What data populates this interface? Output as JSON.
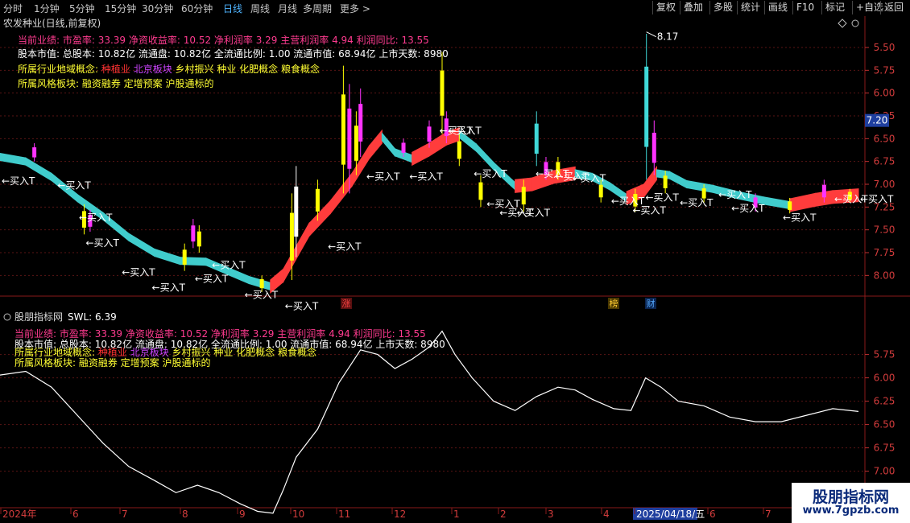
{
  "toolbar": {
    "left": [
      {
        "label": "分时",
        "active": false
      },
      {
        "label": "1分钟",
        "active": false
      },
      {
        "label": "5分钟",
        "active": false
      },
      {
        "label": "15分钟",
        "active": false
      },
      {
        "label": "30分钟",
        "active": false
      },
      {
        "label": "60分钟",
        "active": false
      },
      {
        "label": "日线",
        "active": true
      },
      {
        "label": "周线",
        "active": false
      },
      {
        "label": "月线",
        "active": false
      },
      {
        "label": "多周期",
        "active": false
      },
      {
        "label": "更多 >",
        "active": false
      }
    ],
    "right": [
      "复权",
      "叠加",
      "多股",
      "统计",
      "画线",
      "F10",
      "标记",
      "+自选",
      "返回"
    ]
  },
  "main": {
    "title": "农发种业(日线,前复权)",
    "info_lines": [
      {
        "text": "当前业绩: 市盈率: 33.39 净资收益率: 10.52 净利润率 3.29 主营利润率 4.94 利润同比: 13.55",
        "color": "#ff3b8f"
      },
      {
        "text": "股本市值: 总股本: 10.82亿 流通盘: 10.82亿 全流通比例: 1.00 流通市值: 68.94亿 上市天数: 8980",
        "color": "#ffffff"
      },
      {
        "parts": [
          {
            "text": "所属行业地域概念:",
            "color": "#ffff33"
          },
          {
            "text": "种植业",
            "color": "#ff3333"
          },
          {
            "text": "北京板块",
            "color": "#cc44ff"
          },
          {
            "text": "乡村振兴 种业 化肥概念 粮食概念",
            "color": "#ffff33"
          }
        ]
      },
      {
        "parts": [
          {
            "text": "所属风格板块:",
            "color": "#ffff33"
          },
          {
            "text": "融资融券 定增预案 沪股通标的",
            "color": "#ffff33"
          }
        ]
      }
    ],
    "y_ticks": [
      "8.00",
      "7.75",
      "7.50",
      "7.25",
      "7.00",
      "6.75",
      "6.50",
      "6.25",
      "6.00",
      "5.75",
      "5.50"
    ],
    "current_price": "7.20",
    "high_label": "8.17",
    "buy_label": "←买入T",
    "event_badges": [
      {
        "label": "涨",
        "color": "#ff4444",
        "bg": "#5a1010"
      },
      {
        "label": "榜",
        "color": "#ffcc33",
        "bg": "#4a3800"
      },
      {
        "label": "财",
        "color": "#55aaff",
        "bg": "#0a2450"
      }
    ]
  },
  "sub": {
    "title": "股朋指标网",
    "value_label": "SWL: 6.39",
    "y_ticks": [
      "7.00",
      "6.75",
      "6.50",
      "6.25",
      "6.00",
      "5.75"
    ]
  },
  "x_axis": {
    "labels": [
      "2024年",
      "6",
      "7",
      "8",
      "9",
      "10",
      "11",
      "12",
      "1",
      "2",
      "3",
      "4",
      "2025/04/18/五",
      "6",
      "7"
    ]
  },
  "watermark": {
    "line1": "股朋指标网",
    "line2": "www.7gpzb.com"
  },
  "colors": {
    "up": "#ff3232",
    "down": "#40d8d8",
    "band_up": "#ff3c3c",
    "band_down": "#40cccc",
    "buy": "#ffffff",
    "candle_hi": "#ffff00",
    "candle_mag": "#ff33ff"
  },
  "chart_data": [
    {
      "type": "candlestick-band",
      "title": "农发种业(日线,前复权)",
      "x_range": [
        "2024-04",
        "2025-08"
      ],
      "ylim": [
        5.3,
        8.3
      ],
      "y_ticks": [
        5.5,
        5.75,
        6.0,
        6.25,
        6.5,
        6.75,
        7.0,
        7.25,
        7.5,
        7.75,
        8.0
      ],
      "band": [
        {
          "x": 0.0,
          "y": 6.8
        },
        {
          "x": 0.03,
          "y": 6.75
        },
        {
          "x": 0.06,
          "y": 6.58
        },
        {
          "x": 0.09,
          "y": 6.35
        },
        {
          "x": 0.12,
          "y": 6.15
        },
        {
          "x": 0.15,
          "y": 5.92
        },
        {
          "x": 0.18,
          "y": 5.75
        },
        {
          "x": 0.21,
          "y": 5.66
        },
        {
          "x": 0.24,
          "y": 5.65
        },
        {
          "x": 0.265,
          "y": 5.55
        },
        {
          "x": 0.29,
          "y": 5.45
        },
        {
          "x": 0.315,
          "y": 5.38
        },
        {
          "x": 0.33,
          "y": 5.5
        },
        {
          "x": 0.345,
          "y": 5.75
        },
        {
          "x": 0.36,
          "y": 6.0
        },
        {
          "x": 0.385,
          "y": 6.25
        },
        {
          "x": 0.41,
          "y": 6.55
        },
        {
          "x": 0.43,
          "y": 6.85
        },
        {
          "x": 0.445,
          "y": 7.02
        },
        {
          "x": 0.46,
          "y": 6.85
        },
        {
          "x": 0.48,
          "y": 6.78
        },
        {
          "x": 0.5,
          "y": 6.88
        },
        {
          "x": 0.52,
          "y": 7.0
        },
        {
          "x": 0.535,
          "y": 7.05
        },
        {
          "x": 0.555,
          "y": 6.9
        },
        {
          "x": 0.575,
          "y": 6.7
        },
        {
          "x": 0.6,
          "y": 6.48
        },
        {
          "x": 0.62,
          "y": 6.5
        },
        {
          "x": 0.645,
          "y": 6.58
        },
        {
          "x": 0.67,
          "y": 6.62
        },
        {
          "x": 0.69,
          "y": 6.58
        },
        {
          "x": 0.71,
          "y": 6.48
        },
        {
          "x": 0.73,
          "y": 6.35
        },
        {
          "x": 0.75,
          "y": 6.43
        },
        {
          "x": 0.765,
          "y": 6.62
        },
        {
          "x": 0.78,
          "y": 6.6
        },
        {
          "x": 0.8,
          "y": 6.5
        },
        {
          "x": 0.83,
          "y": 6.45
        },
        {
          "x": 0.86,
          "y": 6.38
        },
        {
          "x": 0.89,
          "y": 6.32
        },
        {
          "x": 0.92,
          "y": 6.27
        },
        {
          "x": 0.95,
          "y": 6.33
        },
        {
          "x": 0.97,
          "y": 6.36
        },
        {
          "x": 1.0,
          "y": 6.38
        }
      ],
      "candles": [
        {
          "x": 0.04,
          "h": 6.95,
          "l": 6.75,
          "c": "mag"
        },
        {
          "x": 0.098,
          "h": 6.28,
          "l": 5.95,
          "c": "yel"
        },
        {
          "x": 0.105,
          "h": 6.22,
          "l": 5.98,
          "c": "mag"
        },
        {
          "x": 0.215,
          "h": 5.85,
          "l": 5.55,
          "c": "yel"
        },
        {
          "x": 0.225,
          "h": 6.12,
          "l": 5.8,
          "c": "mag"
        },
        {
          "x": 0.232,
          "h": 6.05,
          "l": 5.75,
          "c": "yel"
        },
        {
          "x": 0.305,
          "h": 5.5,
          "l": 5.32,
          "c": "yel"
        },
        {
          "x": 0.34,
          "h": 6.4,
          "l": 5.45,
          "c": "yel"
        },
        {
          "x": 0.345,
          "h": 6.7,
          "l": 5.7,
          "c": "wht"
        },
        {
          "x": 0.37,
          "h": 6.55,
          "l": 6.1,
          "c": "yel"
        },
        {
          "x": 0.4,
          "h": 7.8,
          "l": 6.4,
          "c": "yel"
        },
        {
          "x": 0.407,
          "h": 7.6,
          "l": 6.4,
          "c": "mag"
        },
        {
          "x": 0.415,
          "h": 7.3,
          "l": 6.6,
          "c": "yel"
        },
        {
          "x": 0.42,
          "h": 7.55,
          "l": 6.8,
          "c": "mag"
        },
        {
          "x": 0.47,
          "h": 7.0,
          "l": 6.8,
          "c": "mag"
        },
        {
          "x": 0.5,
          "h": 7.2,
          "l": 6.9,
          "c": "mag"
        },
        {
          "x": 0.515,
          "h": 7.95,
          "l": 7.05,
          "c": "yel"
        },
        {
          "x": 0.52,
          "h": 7.3,
          "l": 6.95,
          "c": "mag"
        },
        {
          "x": 0.535,
          "h": 7.05,
          "l": 6.7,
          "c": "yel"
        },
        {
          "x": 0.56,
          "h": 6.6,
          "l": 6.25,
          "c": "yel"
        },
        {
          "x": 0.61,
          "h": 6.55,
          "l": 6.2,
          "c": "yel"
        },
        {
          "x": 0.625,
          "h": 7.3,
          "l": 6.7,
          "c": "cyn"
        },
        {
          "x": 0.636,
          "h": 6.8,
          "l": 6.55,
          "c": "mag"
        },
        {
          "x": 0.65,
          "h": 6.8,
          "l": 6.55,
          "c": "yel"
        },
        {
          "x": 0.7,
          "h": 6.55,
          "l": 6.3,
          "c": "yel"
        },
        {
          "x": 0.74,
          "h": 6.45,
          "l": 6.2,
          "c": "yel"
        },
        {
          "x": 0.753,
          "h": 8.15,
          "l": 6.55,
          "c": "cyn"
        },
        {
          "x": 0.762,
          "h": 7.2,
          "l": 6.6,
          "c": "mag"
        },
        {
          "x": 0.775,
          "h": 6.65,
          "l": 6.4,
          "c": "yel"
        },
        {
          "x": 0.82,
          "h": 6.5,
          "l": 6.3,
          "c": "yel"
        },
        {
          "x": 0.88,
          "h": 6.4,
          "l": 6.2,
          "c": "mag"
        },
        {
          "x": 0.92,
          "h": 6.35,
          "l": 6.18,
          "c": "yel"
        },
        {
          "x": 0.96,
          "h": 6.55,
          "l": 6.3,
          "c": "mag"
        },
        {
          "x": 0.99,
          "h": 6.45,
          "l": 6.3,
          "c": "yel"
        }
      ],
      "buy_signals": [
        {
          "x": 0.0,
          "y": 6.5
        },
        {
          "x": 0.065,
          "y": 6.45
        },
        {
          "x": 0.09,
          "y": 6.1
        },
        {
          "x": 0.098,
          "y": 5.82
        },
        {
          "x": 0.14,
          "y": 5.5
        },
        {
          "x": 0.175,
          "y": 5.33
        },
        {
          "x": 0.225,
          "y": 5.43
        },
        {
          "x": 0.245,
          "y": 5.58
        },
        {
          "x": 0.283,
          "y": 5.25
        },
        {
          "x": 0.33,
          "y": 5.13
        },
        {
          "x": 0.38,
          "y": 5.78
        },
        {
          "x": 0.425,
          "y": 6.55
        },
        {
          "x": 0.475,
          "y": 6.55
        },
        {
          "x": 0.51,
          "y": 7.05
        },
        {
          "x": 0.52,
          "y": 7.05
        },
        {
          "x": 0.55,
          "y": 6.58
        },
        {
          "x": 0.565,
          "y": 6.25
        },
        {
          "x": 0.58,
          "y": 6.15
        },
        {
          "x": 0.6,
          "y": 6.15
        },
        {
          "x": 0.622,
          "y": 6.58
        },
        {
          "x": 0.645,
          "y": 6.55
        },
        {
          "x": 0.665,
          "y": 6.53
        },
        {
          "x": 0.71,
          "y": 6.28
        },
        {
          "x": 0.735,
          "y": 6.18
        },
        {
          "x": 0.75,
          "y": 6.32
        },
        {
          "x": 0.79,
          "y": 6.26
        },
        {
          "x": 0.835,
          "y": 6.35
        },
        {
          "x": 0.85,
          "y": 6.2
        },
        {
          "x": 0.91,
          "y": 6.1
        },
        {
          "x": 0.97,
          "y": 6.3
        },
        {
          "x": 1.0,
          "y": 6.3
        }
      ]
    },
    {
      "type": "line",
      "title": "股朋指标网",
      "series": [
        {
          "name": "SWL",
          "points": [
            {
              "x": 0.0,
              "y": 6.78
            },
            {
              "x": 0.03,
              "y": 6.82
            },
            {
              "x": 0.06,
              "y": 6.65
            },
            {
              "x": 0.09,
              "y": 6.35
            },
            {
              "x": 0.12,
              "y": 6.05
            },
            {
              "x": 0.15,
              "y": 5.8
            },
            {
              "x": 0.18,
              "y": 5.65
            },
            {
              "x": 0.205,
              "y": 5.52
            },
            {
              "x": 0.23,
              "y": 5.6
            },
            {
              "x": 0.255,
              "y": 5.52
            },
            {
              "x": 0.28,
              "y": 5.4
            },
            {
              "x": 0.3,
              "y": 5.32
            },
            {
              "x": 0.318,
              "y": 5.3
            },
            {
              "x": 0.33,
              "y": 5.55
            },
            {
              "x": 0.345,
              "y": 5.9
            },
            {
              "x": 0.37,
              "y": 6.2
            },
            {
              "x": 0.395,
              "y": 6.7
            },
            {
              "x": 0.42,
              "y": 7.05
            },
            {
              "x": 0.44,
              "y": 7.0
            },
            {
              "x": 0.46,
              "y": 6.85
            },
            {
              "x": 0.48,
              "y": 6.95
            },
            {
              "x": 0.5,
              "y": 7.08
            },
            {
              "x": 0.515,
              "y": 7.25
            },
            {
              "x": 0.53,
              "y": 7.0
            },
            {
              "x": 0.55,
              "y": 6.75
            },
            {
              "x": 0.575,
              "y": 6.5
            },
            {
              "x": 0.6,
              "y": 6.4
            },
            {
              "x": 0.625,
              "y": 6.55
            },
            {
              "x": 0.65,
              "y": 6.65
            },
            {
              "x": 0.67,
              "y": 6.62
            },
            {
              "x": 0.69,
              "y": 6.52
            },
            {
              "x": 0.715,
              "y": 6.42
            },
            {
              "x": 0.735,
              "y": 6.4
            },
            {
              "x": 0.752,
              "y": 6.75
            },
            {
              "x": 0.77,
              "y": 6.65
            },
            {
              "x": 0.79,
              "y": 6.5
            },
            {
              "x": 0.82,
              "y": 6.45
            },
            {
              "x": 0.85,
              "y": 6.33
            },
            {
              "x": 0.88,
              "y": 6.28
            },
            {
              "x": 0.91,
              "y": 6.28
            },
            {
              "x": 0.94,
              "y": 6.35
            },
            {
              "x": 0.97,
              "y": 6.42
            },
            {
              "x": 1.0,
              "y": 6.39
            }
          ]
        }
      ],
      "ylim": [
        5.35,
        7.35
      ],
      "y_ticks": [
        5.75,
        6.0,
        6.25,
        6.5,
        6.75,
        7.0
      ]
    }
  ]
}
